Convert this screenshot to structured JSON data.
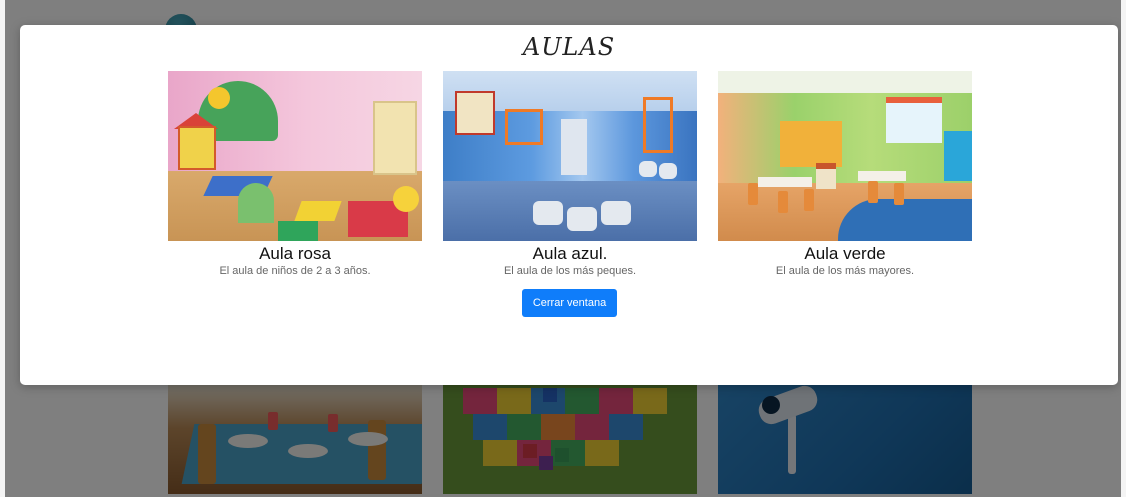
{
  "modal": {
    "title": "AULAS",
    "close_button_label": "Cerrar ventana",
    "cards": [
      {
        "title": "Aula rosa",
        "subtitle": "El aula de niños de 2 a 3 años."
      },
      {
        "title": "Aula azul.",
        "subtitle": "El aula de los más peques."
      },
      {
        "title": "Aula verde",
        "subtitle": "El aula de los más mayores."
      }
    ]
  },
  "colors": {
    "primary_button": "#0f7dfa",
    "overlay": "rgba(0,0,0,0.5)",
    "modal_bg": "#ffffff"
  },
  "background": {
    "images": [
      "food-table-photo",
      "foam-mat-blocks-photo",
      "security-camera-photo"
    ]
  }
}
